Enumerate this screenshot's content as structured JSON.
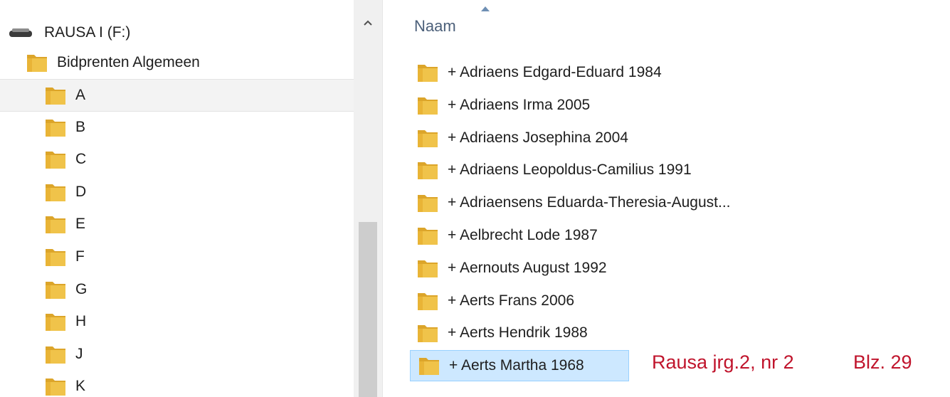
{
  "nav": {
    "drive_label": "RAUSA I (F:)",
    "root_folder": "Bidprenten Algemeen",
    "letters": [
      "A",
      "B",
      "C",
      "D",
      "E",
      "F",
      "G",
      "H",
      "J",
      "K"
    ],
    "selected_index": 0
  },
  "content": {
    "column_header": "Naam",
    "items": [
      "+ Adriaens Edgard-Eduard 1984",
      "+ Adriaens Irma 2005",
      "+ Adriaens Josephina 2004",
      "+ Adriaens Leopoldus-Camilius 1991",
      "+ Adriaensens Eduarda-Theresia-August...",
      "+ Aelbrecht Lode 1987",
      "+ Aernouts August 1992",
      "+ Aerts Frans 2006",
      "+ Aerts Hendrik 1988",
      "+ Aerts Martha 1968"
    ],
    "selected_index": 9
  },
  "caption": {
    "left": "Rausa jrg.2, nr 2",
    "right": "Blz. 29"
  },
  "colors": {
    "folder_yellow": "#f0c34a",
    "folder_dark": "#dca52a",
    "selection": "#cde8ff",
    "caption_red": "#c0142c",
    "header_blue": "#4c607a"
  },
  "icons": {
    "drive": "usb-drive-icon",
    "folder": "folder-icon",
    "scroll_up": "chevron-up-icon",
    "sort": "sort-ascending-icon"
  }
}
